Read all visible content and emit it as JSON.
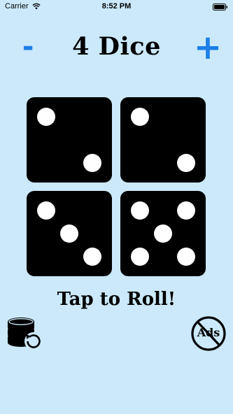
{
  "status_bar": {
    "carrier": "Carrier",
    "time": "8:52 PM"
  },
  "header": {
    "minus_label": "-",
    "title": "4 Dice",
    "plus_label": "+"
  },
  "dice": [
    {
      "value": 2
    },
    {
      "value": 2
    },
    {
      "value": 3
    },
    {
      "value": 5
    }
  ],
  "roll_label": "Tap to Roll!",
  "bottom": {
    "restore_icon": "coins-restore-icon",
    "no_ads_label": "Ads"
  },
  "colors": {
    "background": "#cbe9fb",
    "accent": "#1d7ee6",
    "die": "#000000",
    "pip": "#ffffff"
  }
}
